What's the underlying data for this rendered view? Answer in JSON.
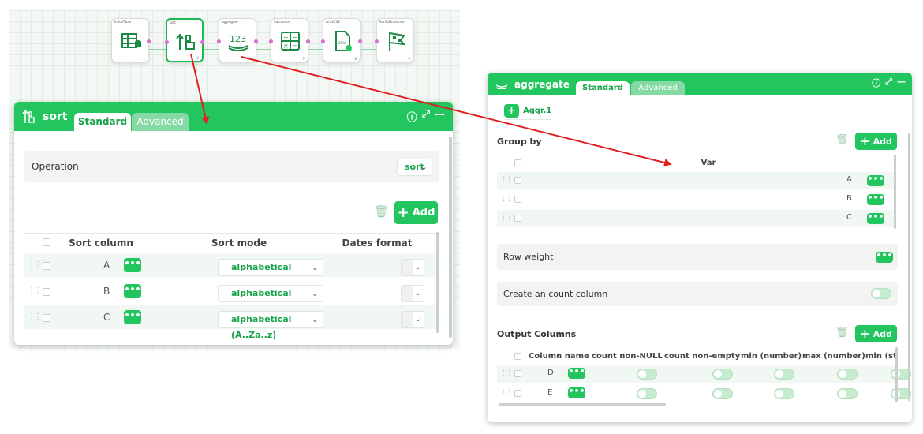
{
  "workflow": {
    "nodes": [
      {
        "label": "InlineTable",
        "num": "1",
        "icon": "table-icon"
      },
      {
        "label": "sort",
        "num": "2",
        "icon": "sort-icon"
      },
      {
        "label": "aggregate",
        "num": "4",
        "icon": "aggregate-icon"
      },
      {
        "label": "Calculator",
        "num": "7",
        "icon": "calculator-icon"
      },
      {
        "label": "writeCSV",
        "num": "8",
        "icon": "csv-file-icon"
      },
      {
        "label": "RunToFinishLine",
        "num": "9",
        "icon": "finish-flag-icon"
      }
    ]
  },
  "sort_panel": {
    "title": "sort",
    "tabs": [
      "Standard",
      "Advanced"
    ],
    "operation_label": "Operation",
    "operation_value": "sort",
    "add_label": "Add",
    "headers": [
      "Sort column",
      "Sort mode",
      "Dates format"
    ],
    "rows": [
      {
        "column": "A",
        "mode": "alphabetical (A..Za..z)"
      },
      {
        "column": "B",
        "mode": "alphabetical (A..Za..z)"
      },
      {
        "column": "C",
        "mode": "alphabetical (A..Za..z)"
      }
    ]
  },
  "aggregate_panel": {
    "title": "aggregate",
    "tabs": [
      "Standard",
      "Advanced"
    ],
    "aggr_label": "Aggr.1",
    "group_by_label": "Group by",
    "add_label": "Add",
    "var_header": "Var",
    "group_rows": [
      "A",
      "B",
      "C"
    ],
    "row_weight_label": "Row weight",
    "count_column_label": "Create an count column",
    "output_columns_label": "Output Columns",
    "output_headers": [
      "Column name",
      "count non-NULL",
      "count non-empty",
      "min (number)",
      "max (number)",
      "min (st"
    ],
    "output_rows": [
      "D",
      "E"
    ]
  },
  "colors": {
    "accent": "#22c55e",
    "arrow": "#e02020"
  }
}
